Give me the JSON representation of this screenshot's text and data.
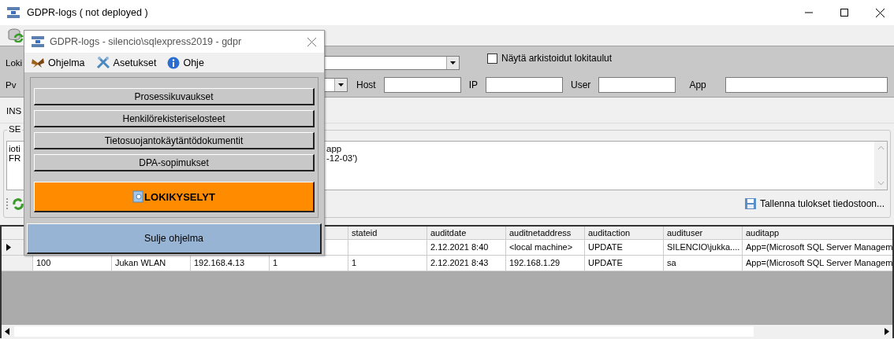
{
  "window": {
    "title": "GDPR-logs ( not deployed )"
  },
  "filters": {
    "log_label": "Loki",
    "date_label": "Pv",
    "archived": {
      "label": "Näytä arkistoidut lokitaulut",
      "checked": false
    },
    "fields": [
      {
        "label": "Host"
      },
      {
        "label": "IP"
      },
      {
        "label": "User"
      },
      {
        "label": "App"
      }
    ]
  },
  "tab": {
    "label": "INS"
  },
  "group": {
    "label": "SE"
  },
  "query_lines": [
    {
      "start": "ioti",
      "end": "app"
    },
    {
      "start": "FR",
      "end": "-12-03')"
    }
  ],
  "save_button": {
    "label": "Tallenna tulokset tiedostoon..."
  },
  "grid": {
    "columns": [
      "",
      "",
      "",
      "",
      "stateid",
      "auditdate",
      "auditnetaddress",
      "auditaction",
      "audituser",
      "auditapp"
    ],
    "rows": [
      {
        "selected": true,
        "cells": [
          "",
          "",
          "",
          "",
          "",
          "2.12.2021 8:40",
          "<local machine>",
          "UPDATE",
          "SILENCIO\\jukka....",
          "App=(Microsoft SQL Server Managem"
        ]
      },
      {
        "selected": false,
        "cells": [
          "100",
          "Jukan WLAN",
          "192.168.4.13",
          "1",
          "1",
          "2.12.2021 8:43",
          "192.168.1.29",
          "UPDATE",
          "sa",
          "App=(Microsoft SQL Server Managem"
        ]
      }
    ]
  },
  "dialog": {
    "title": "GDPR-logs - silencio\\sqlexpress2019 - gdpr",
    "menu": [
      {
        "label": "Ohjelma",
        "kind": "program"
      },
      {
        "label": "Asetukset",
        "kind": "settings"
      },
      {
        "label": "Ohje",
        "kind": "help"
      }
    ],
    "buttons": [
      "Prosessikuvaukset",
      "Henkilörekisteriselosteet",
      "Tietosuojantokäytäntödokumentit",
      "DPA-sopimukset"
    ],
    "query_button": {
      "label": "LOKIKYSELYT"
    },
    "close_button": {
      "label": "Sulje ohjelma"
    }
  }
}
